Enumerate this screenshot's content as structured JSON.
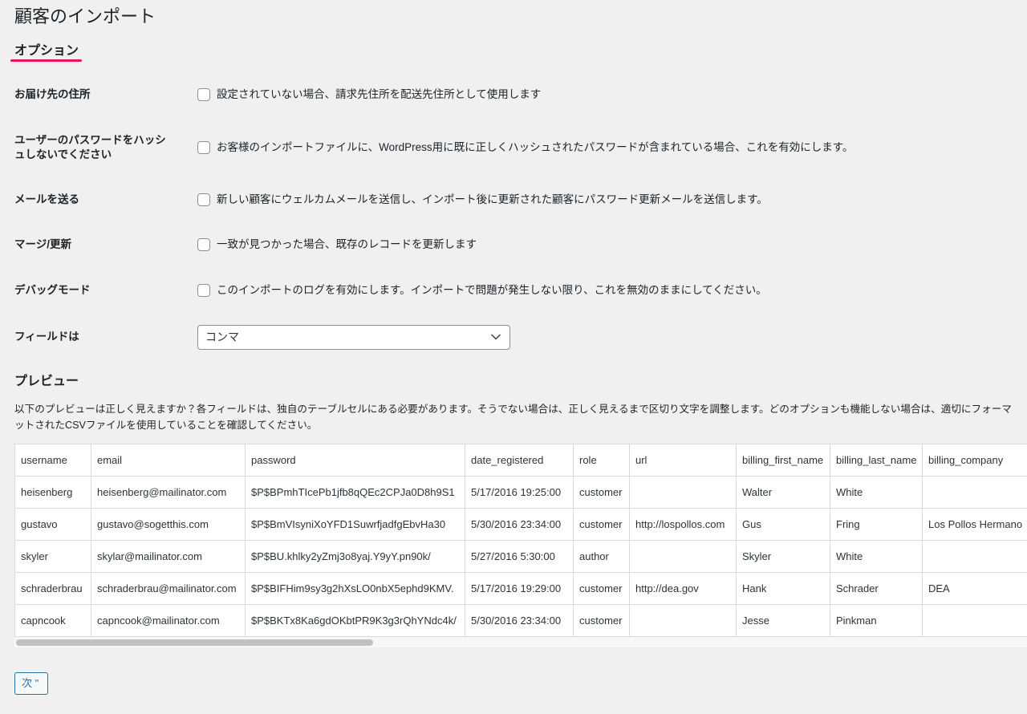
{
  "colors": {
    "background": "#f0f0f1",
    "accent_underline": "#e2185b",
    "primary": "#2271b1"
  },
  "page": {
    "title": "顧客のインポート"
  },
  "options": {
    "heading": "オプション",
    "rows": [
      {
        "label": "お届け先の住所",
        "description": "設定されていない場合、請求先住所を配送先住所として使用します",
        "checked": false
      },
      {
        "label": "ユーザーのパスワードをハッシュしないでください",
        "description": "お客様のインポートファイルに、WordPress用に既に正しくハッシュされたパスワードが含まれている場合、これを有効にします。",
        "checked": false
      },
      {
        "label": "メールを送る",
        "description": "新しい顧客にウェルカムメールを送信し、インポート後に更新された顧客にパスワード更新メールを送信します。",
        "checked": false
      },
      {
        "label": "マージ/更新",
        "description": "一致が見つかった場合、既存のレコードを更新します",
        "checked": false
      },
      {
        "label": "デバッグモード",
        "description": "このインポートのログを有効にします。インポートで問題が発生しない限り、これを無効のままにしてください。",
        "checked": false
      }
    ],
    "delimiter": {
      "label": "フィールドは",
      "selected": "コンマ",
      "icon": "chevron-down-icon"
    }
  },
  "preview": {
    "heading": "プレビュー",
    "description": "以下のプレビューは正しく見えますか？各フィールドは、独自のテーブルセルにある必要があります。そうでない場合は、正しく見えるまで区切り文字を調整します。どのオプションも機能しない場合は、適切にフォーマットされたCSVファイルを使用していることを確認してください。",
    "columns": [
      "username",
      "email",
      "password",
      "date_registered",
      "role",
      "url",
      "billing_first_name",
      "billing_last_name",
      "billing_company"
    ],
    "rows": [
      [
        "heisenberg",
        "heisenberg@mailinator.com",
        "$P$BPmhTIcePb1jfb8qQEc2CPJa0D8h9S1",
        "5/17/2016 19:25:00",
        "customer",
        "",
        "Walter",
        "White",
        ""
      ],
      [
        "gustavo",
        "gustavo@sogetthis.com",
        "$P$BmVIsyniXoYFD1SuwrfjadfgEbvHa30",
        "5/30/2016 23:34:00",
        "customer",
        "http://lospollos.com",
        "Gus",
        "Fring",
        "Los Pollos Hermano"
      ],
      [
        "skyler",
        "skylar@mailinator.com",
        "$P$BU.khlky2yZmj3o8yaj.Y9yY.pn90k/",
        "5/27/2016 5:30:00",
        "author",
        "",
        "Skyler",
        "White",
        ""
      ],
      [
        "schraderbrau",
        "schraderbrau@mailinator.com",
        "$P$BIFHim9sy3g2hXsLO0nbX5ephd9KMV.",
        "5/17/2016 19:29:00",
        "customer",
        "http://dea.gov",
        "Hank",
        "Schrader",
        "DEA"
      ],
      [
        "capncook",
        "capncook@mailinator.com",
        "$P$BKTx8Ka6gdOKbtPR9K3g3rQhYNdc4k/",
        "5/30/2016 23:34:00",
        "customer",
        "",
        "Jesse",
        "Pinkman",
        ""
      ]
    ]
  },
  "actions": {
    "next_label": "次 \""
  }
}
